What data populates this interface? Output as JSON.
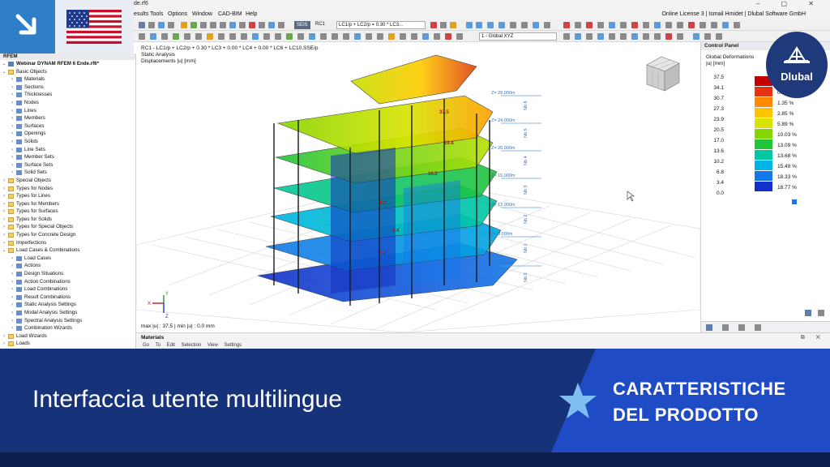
{
  "window": {
    "title": "de.rf6",
    "controls": "– ▢ ✕"
  },
  "menu": {
    "items": [
      "esults",
      "Tools",
      "Options",
      "Window",
      "CAD-BIM",
      "Help"
    ],
    "license": "Online License 3 | Ismail Hmidet | Dlubal Software GmbH"
  },
  "toolbar": {
    "lc_tag": "SEIS",
    "lc_name": "RC1",
    "lc_combo": "LC1/p + LC2/p = 0.30 * LC3...",
    "view_combo": "1 - Global XYZ"
  },
  "navigator": {
    "header": "RFEM",
    "project": "Webinar DYNAM RFEM 6 Ende.rf6*",
    "items": [
      {
        "label": "Basic Objects",
        "level": 1,
        "folder": true,
        "open": true
      },
      {
        "label": "Materials",
        "level": 2
      },
      {
        "label": "Sections",
        "level": 2
      },
      {
        "label": "Thicknesses",
        "level": 2
      },
      {
        "label": "Nodes",
        "level": 2
      },
      {
        "label": "Lines",
        "level": 2
      },
      {
        "label": "Members",
        "level": 2
      },
      {
        "label": "Surfaces",
        "level": 2
      },
      {
        "label": "Openings",
        "level": 2
      },
      {
        "label": "Solids",
        "level": 2
      },
      {
        "label": "Line Sets",
        "level": 2
      },
      {
        "label": "Member Sets",
        "level": 2
      },
      {
        "label": "Surface Sets",
        "level": 2
      },
      {
        "label": "Solid Sets",
        "level": 2
      },
      {
        "label": "Special Objects",
        "level": 1,
        "folder": true
      },
      {
        "label": "Types for Nodes",
        "level": 1,
        "folder": true
      },
      {
        "label": "Types for Lines",
        "level": 1,
        "folder": true
      },
      {
        "label": "Types for Members",
        "level": 1,
        "folder": true
      },
      {
        "label": "Types for Surfaces",
        "level": 1,
        "folder": true
      },
      {
        "label": "Types for Solids",
        "level": 1,
        "folder": true
      },
      {
        "label": "Types for Special Objects",
        "level": 1,
        "folder": true
      },
      {
        "label": "Types for Concrete Design",
        "level": 1,
        "folder": true
      },
      {
        "label": "Imperfections",
        "level": 1,
        "folder": true
      },
      {
        "label": "Load Cases & Combinations",
        "level": 1,
        "folder": true,
        "open": true
      },
      {
        "label": "Load Cases",
        "level": 2
      },
      {
        "label": "Actions",
        "level": 2
      },
      {
        "label": "Design Situations",
        "level": 2
      },
      {
        "label": "Action Combinations",
        "level": 2
      },
      {
        "label": "Load Combinations",
        "level": 2
      },
      {
        "label": "Result Combinations",
        "level": 2
      },
      {
        "label": "Static Analysis Settings",
        "level": 2
      },
      {
        "label": "Modal Analysis Settings",
        "level": 2
      },
      {
        "label": "Spectral Analysis Settings",
        "level": 2
      },
      {
        "label": "Combination Wizards",
        "level": 2
      },
      {
        "label": "Load Wizards",
        "level": 1,
        "folder": true
      },
      {
        "label": "Loads",
        "level": 1,
        "folder": true
      }
    ]
  },
  "viewport": {
    "line1": "RC1 - LC1/p + LC2/p + 0.30 * LC3 + 0.00 * LC4 + 0.00 * LC6 + LC10.SSE/p",
    "line2": "Static Analysis",
    "line3": "Displacements |u| [mm]",
    "max_info": "max |u| : 37.5 | min |u| : 0.0 mm",
    "axes": {
      "x": "X",
      "y": "Y",
      "z": "Z"
    }
  },
  "control_panel": {
    "header": "Control Panel",
    "title": "Global Deformations",
    "unit": "|u| [mm]",
    "legend": [
      {
        "value": "37.5",
        "color": "#c40000",
        "pct": ""
      },
      {
        "value": "34.1",
        "color": "#e53212",
        "pct": "0.44 %"
      },
      {
        "value": "30.7",
        "color": "#ff8a00",
        "pct": "1.35 %"
      },
      {
        "value": "27.3",
        "color": "#ffc400",
        "pct": "2.85 %"
      },
      {
        "value": "23.9",
        "color": "#d8e400",
        "pct": "5.89 %"
      },
      {
        "value": "20.5",
        "color": "#86d600",
        "pct": "10.03 %"
      },
      {
        "value": "17.0",
        "color": "#22c43a",
        "pct": "13.09 %"
      },
      {
        "value": "13.6",
        "color": "#00c8a0",
        "pct": "13.68 %"
      },
      {
        "value": "10.2",
        "color": "#00b4e6",
        "pct": "15.49 %"
      },
      {
        "value": "6.8",
        "color": "#1478e8",
        "pct": "18.33 %"
      },
      {
        "value": "3.4",
        "color": "#1430c8",
        "pct": "18.77 %"
      },
      {
        "value": "0.0",
        "color": "#0a0a90",
        "pct": ""
      }
    ]
  },
  "model_labels": {
    "levels": [
      "Z= 28.000m",
      "Z= 24.000m",
      "Z= 20.000m",
      "Z= 16.000m",
      "Z= 12.000m",
      "Z= 8.000m",
      "Z= 4.000m"
    ],
    "storeys": [
      "Nb 6",
      "Nb 5",
      "Nb 4",
      "Nb 3",
      "Nb 2",
      "Nb 1",
      "Nb 0"
    ],
    "values": [
      "37.5",
      "19.8",
      "16.2",
      "8.2",
      "5.4",
      "2.0"
    ]
  },
  "materials_panel": {
    "title": "Materials",
    "menu": "Go To   Edit   Selection   View   Settings",
    "buttons": "⧉ ✕"
  },
  "banner": {
    "title": "Interfaccia utente multilingue",
    "feature_line1": "CARATTERISTICHE",
    "feature_line2": "DEL PRODOTTO"
  },
  "brand": {
    "name": "Dlubal",
    "color": "#1e3a7a"
  },
  "colors": {
    "banner_dark": "#16337a",
    "banner_accent": "#1f4cc4",
    "corner_blue": "#2f7fc8"
  }
}
